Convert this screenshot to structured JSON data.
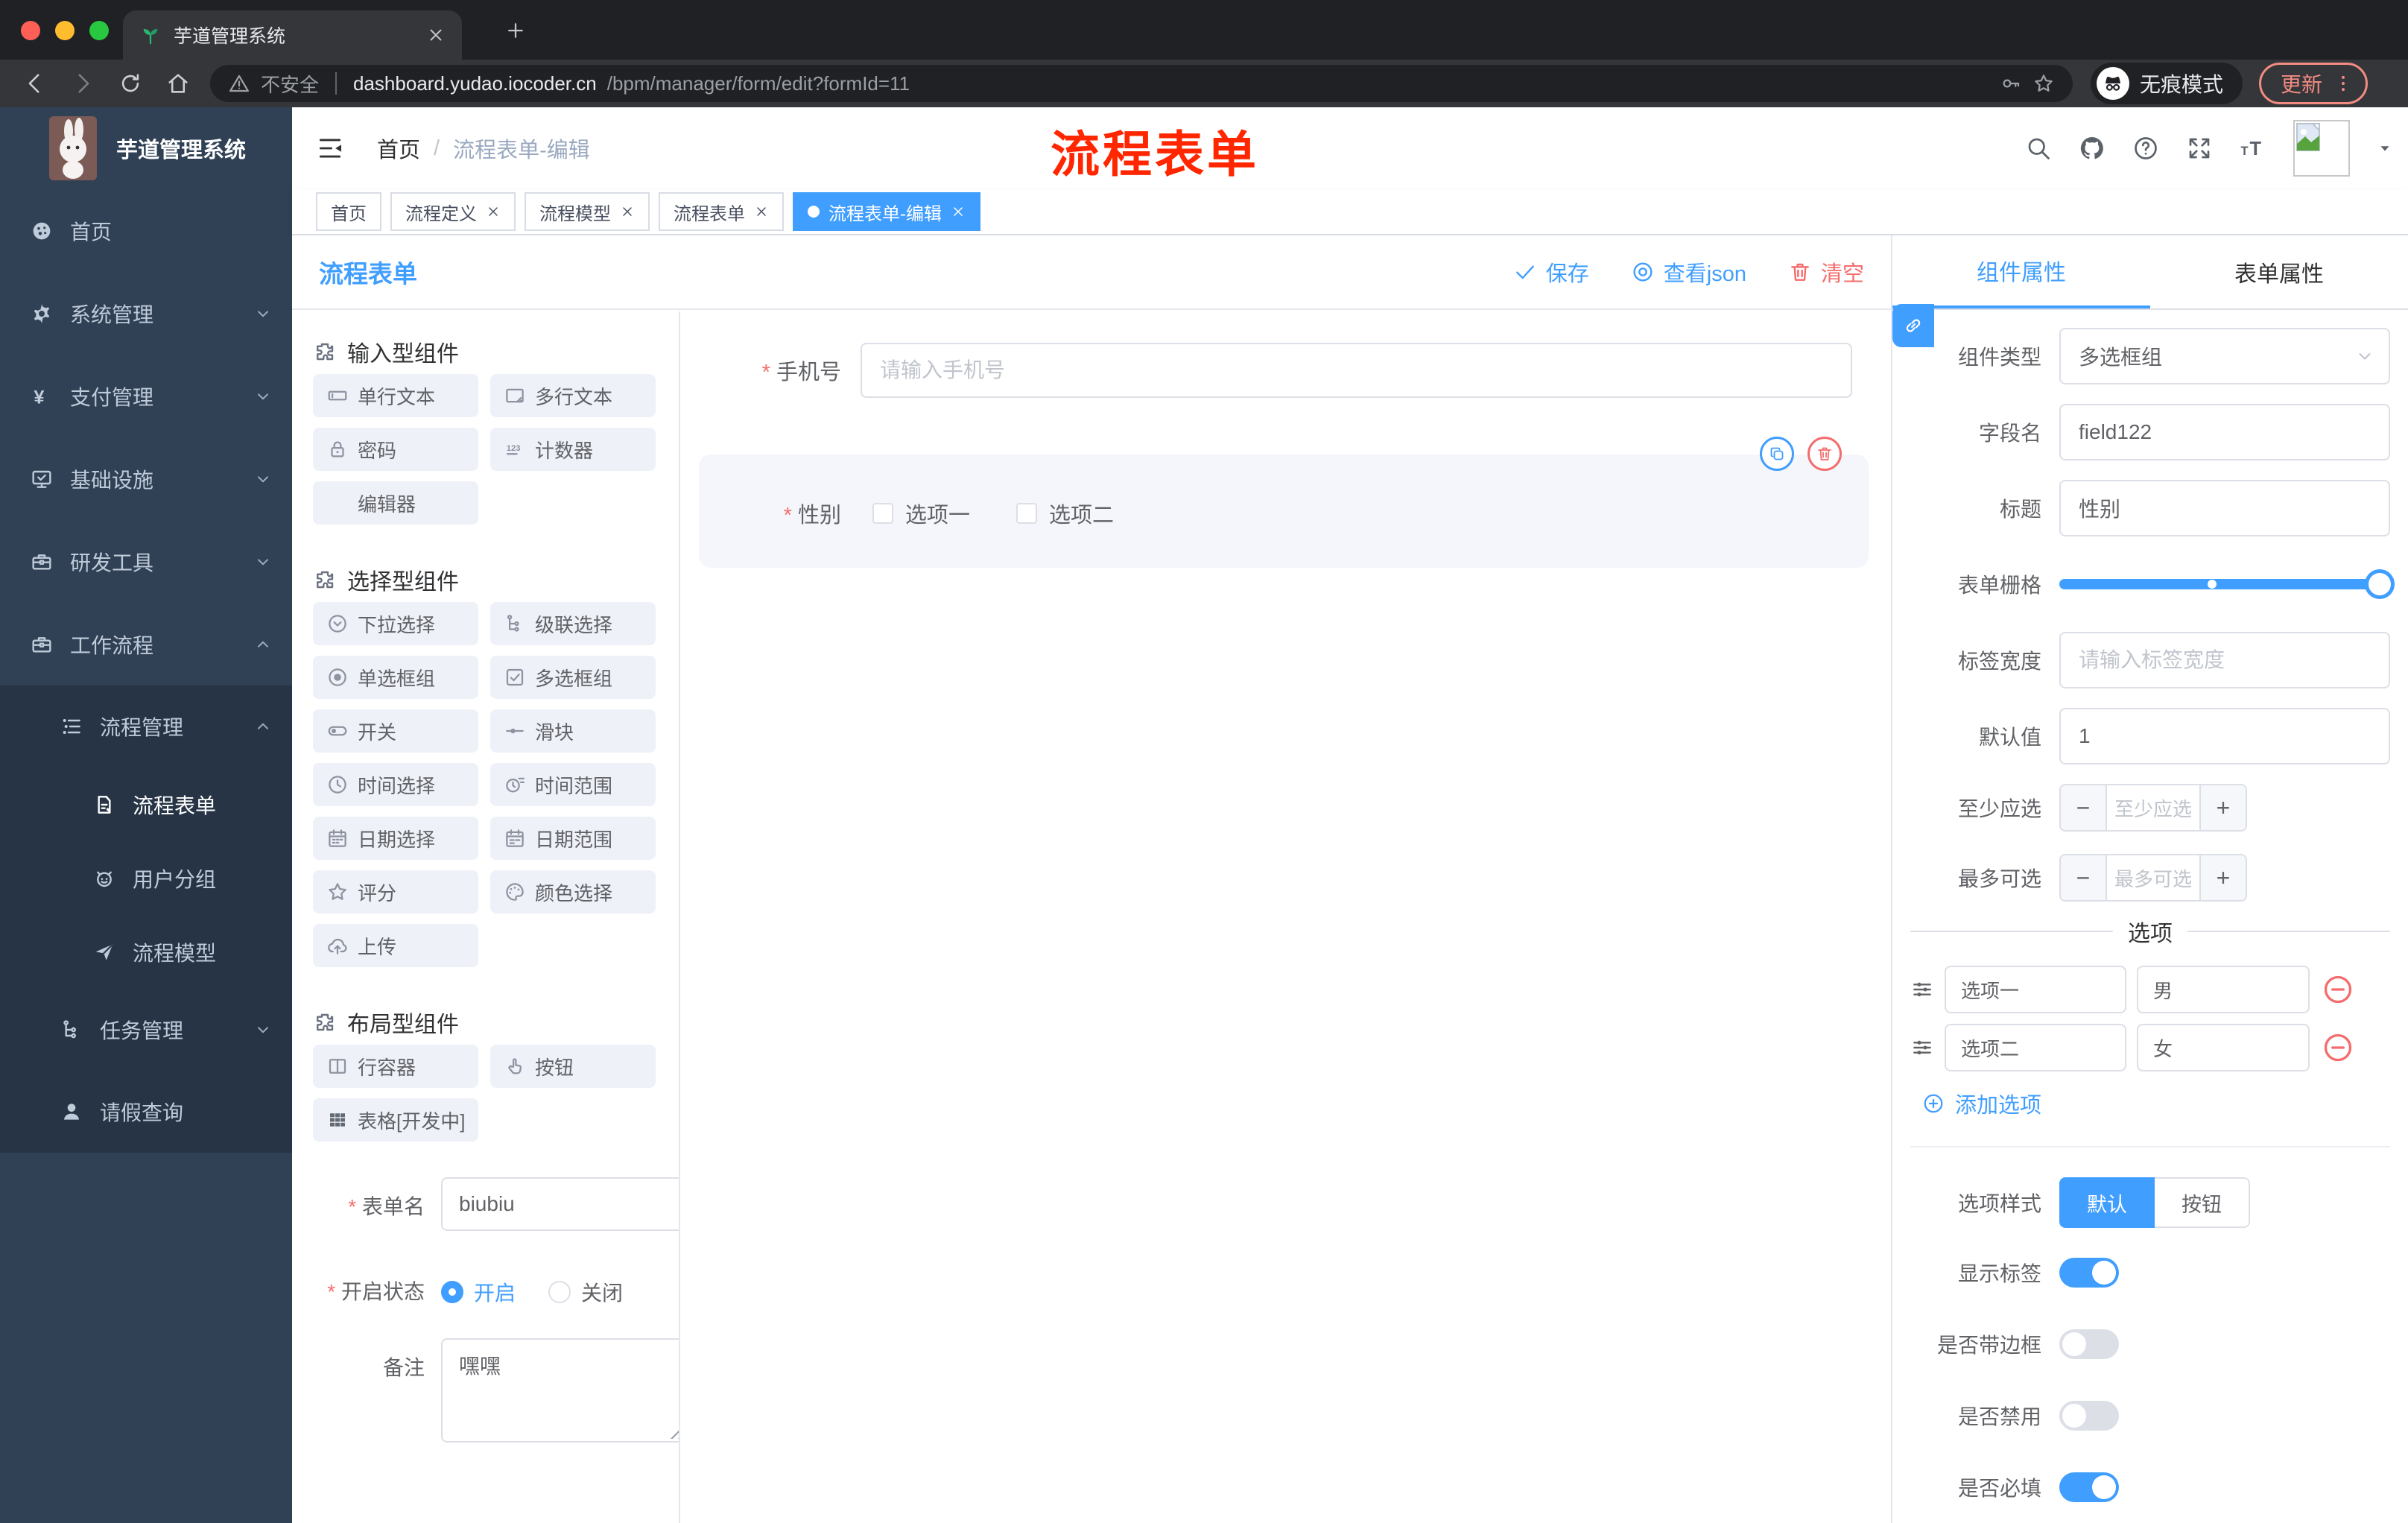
{
  "browser": {
    "tab_title": "芋道管理系统",
    "new_tab": "+",
    "security_label": "不安全",
    "url_domain": "dashboard.yudao.iocoder.cn",
    "url_path": "/bpm/manager/form/edit?formId=11",
    "incognito_label": "无痕模式",
    "update_label": "更新"
  },
  "app": {
    "logo_title": "芋道管理系统",
    "breadcrumb": {
      "root": "首页",
      "separator": "/",
      "current": "流程表单-编辑"
    },
    "annotation": "流程表单"
  },
  "sidebar": {
    "items": [
      {
        "label": "首页",
        "icon": "dashboard"
      },
      {
        "label": "系统管理",
        "icon": "gear"
      },
      {
        "label": "支付管理",
        "icon": "yen"
      },
      {
        "label": "基础设施",
        "icon": "monitor-check"
      },
      {
        "label": "研发工具",
        "icon": "toolbox"
      },
      {
        "label": "工作流程",
        "icon": "toolbox",
        "expanded": true
      },
      {
        "label": "流程管理",
        "icon": "list",
        "expanded": true
      },
      {
        "label": "流程表单",
        "icon": "doc-edit",
        "active": true
      },
      {
        "label": "用户分组",
        "icon": "robot"
      },
      {
        "label": "流程模型",
        "icon": "plane"
      },
      {
        "label": "任务管理",
        "icon": "tree"
      },
      {
        "label": "请假查询",
        "icon": "user"
      }
    ]
  },
  "tags": {
    "items": [
      {
        "label": "首页",
        "closable": false,
        "active": false
      },
      {
        "label": "流程定义",
        "closable": true,
        "active": false
      },
      {
        "label": "流程模型",
        "closable": true,
        "active": false
      },
      {
        "label": "流程表单",
        "closable": true,
        "active": false
      },
      {
        "label": "流程表单-编辑",
        "closable": true,
        "active": true
      }
    ]
  },
  "toolbar": {
    "title": "流程表单",
    "save": "保存",
    "view_json": "查看json",
    "clear": "清空"
  },
  "palette": {
    "sections": [
      {
        "title": "输入型组件",
        "items": [
          {
            "label": "单行文本",
            "icon": "input-box"
          },
          {
            "label": "多行文本",
            "icon": "textarea-box"
          },
          {
            "label": "密码",
            "icon": "lock"
          },
          {
            "label": "计数器",
            "icon": "counter"
          },
          {
            "label": "编辑器",
            "icon": ""
          }
        ]
      },
      {
        "title": "选择型组件",
        "items": [
          {
            "label": "下拉选择",
            "icon": "select-circle"
          },
          {
            "label": "级联选择",
            "icon": "tree"
          },
          {
            "label": "单选框组",
            "icon": "radio-icon"
          },
          {
            "label": "多选框组",
            "icon": "checkbox-icon"
          },
          {
            "label": "开关",
            "icon": "switch-icon"
          },
          {
            "label": "滑块",
            "icon": "slider-icon"
          },
          {
            "label": "时间选择",
            "icon": "clock"
          },
          {
            "label": "时间范围",
            "icon": "clock-range"
          },
          {
            "label": "日期选择",
            "icon": "calendar"
          },
          {
            "label": "日期范围",
            "icon": "calendar-range"
          },
          {
            "label": "评分",
            "icon": "star"
          },
          {
            "label": "颜色选择",
            "icon": "palette"
          },
          {
            "label": "上传",
            "icon": "upload-cloud"
          }
        ]
      },
      {
        "title": "布局型组件",
        "items": [
          {
            "label": "行容器",
            "icon": "columns"
          },
          {
            "label": "按钮",
            "icon": "pointer"
          },
          {
            "label": "表格[开发中]",
            "icon": "grid-filled"
          }
        ]
      }
    ]
  },
  "form_meta": {
    "name_label": "表单名",
    "name_value": "biubiu",
    "status_label": "开启状态",
    "status_on": "开启",
    "status_off": "关闭",
    "remark_label": "备注",
    "remark_value": "嘿嘿"
  },
  "canvas": {
    "phone": {
      "label": "手机号",
      "placeholder": "请输入手机号",
      "required": true
    },
    "gender": {
      "label": "性别",
      "required": true,
      "option1": "选项一",
      "option2": "选项二",
      "selected": true
    }
  },
  "panel": {
    "tabs": [
      {
        "label": "组件属性",
        "active": true
      },
      {
        "label": "表单属性",
        "active": false
      }
    ],
    "component_type": {
      "label": "组件类型",
      "value": "多选框组"
    },
    "field_name": {
      "label": "字段名",
      "value": "field122"
    },
    "title": {
      "label": "标题",
      "value": "性别"
    },
    "grid": {
      "label": "表单栅格"
    },
    "label_width": {
      "label": "标签宽度",
      "placeholder": "请输入标签宽度"
    },
    "default_value": {
      "label": "默认值",
      "value": "1"
    },
    "min_select": {
      "label": "至少应选",
      "placeholder": "至少应选"
    },
    "max_select": {
      "label": "最多可选",
      "placeholder": "最多可选"
    },
    "options": {
      "title": "选项",
      "rows": [
        {
          "label": "选项一",
          "value": "男"
        },
        {
          "label": "选项二",
          "value": "女"
        }
      ],
      "add": "添加选项"
    },
    "option_style": {
      "label": "选项样式",
      "choice_default": "默认",
      "choice_button": "按钮",
      "active": "默认"
    },
    "toggles": [
      {
        "label": "显示标签",
        "on": true
      },
      {
        "label": "是否带边框",
        "on": false
      },
      {
        "label": "是否禁用",
        "on": false
      },
      {
        "label": "是否必填",
        "on": true
      }
    ]
  },
  "colors": {
    "accent": "#409eff",
    "danger": "#f56c6c",
    "annotation": "#ff2600",
    "sidebar_bg": "#304156",
    "sidebar_submenu_bg": "#263445"
  }
}
